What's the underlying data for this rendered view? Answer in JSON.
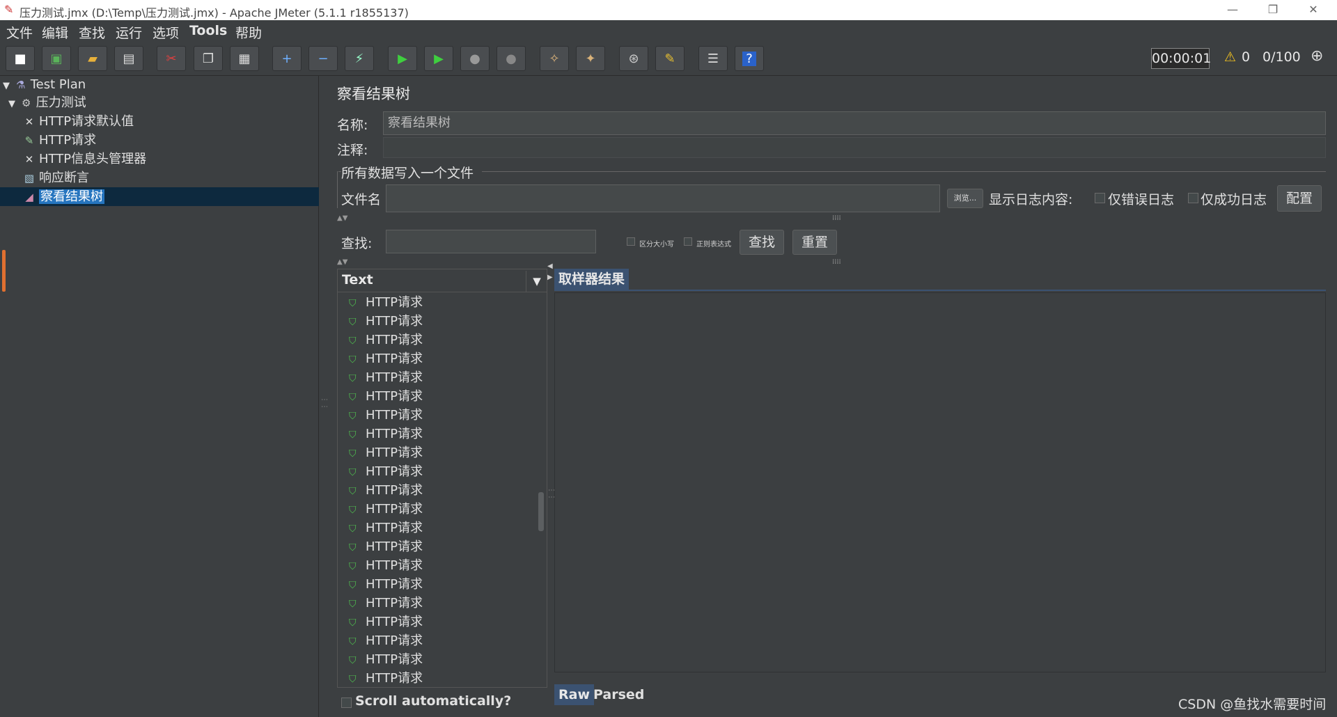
{
  "window": {
    "title": "压力测试.jmx (D:\\Temp\\压力测试.jmx) - Apache JMeter (5.1.1 r1855137)",
    "minimize": "—",
    "restore": "❐",
    "close": "✕"
  },
  "menu": [
    "文件",
    "编辑",
    "查找",
    "运行",
    "选项",
    "Tools",
    "帮助"
  ],
  "toolbar": {
    "icons": [
      "new-icon",
      "templates-icon",
      "open-icon",
      "save-icon",
      "cut-icon",
      "copy-icon",
      "paste-icon",
      "expand-icon",
      "collapse-icon",
      "toggle-icon",
      "start-icon",
      "start-no-pause-icon",
      "stop-icon",
      "shutdown-icon",
      "clear-icon",
      "clear-all-icon",
      "search-icon",
      "reset-search-icon",
      "function-helper-icon",
      "help-icon"
    ],
    "timer": "00:00:01",
    "warnings": "0",
    "threads": "0/100"
  },
  "tree": {
    "items": [
      {
        "label": "Test Plan",
        "icon": "test-plan-icon"
      },
      {
        "label": "压力测试",
        "icon": "thread-group-icon"
      },
      {
        "label": "HTTP请求默认值",
        "icon": "config-icon"
      },
      {
        "label": "HTTP请求",
        "icon": "sampler-icon"
      },
      {
        "label": "HTTP信息头管理器",
        "icon": "config-icon"
      },
      {
        "label": "响应断言",
        "icon": "assertion-icon"
      },
      {
        "label": "察看结果树",
        "icon": "listener-icon"
      }
    ]
  },
  "panel": {
    "title": "察看结果树",
    "name_label": "名称:",
    "name_value": "察看结果树",
    "comment_label": "注释:",
    "file_group_title": "所有数据写入一个文件",
    "filename_label": "文件名",
    "browse_label": "浏览...",
    "log_label": "显示日志内容:",
    "errors_only": "仅错误日志",
    "success_only": "仅成功日志",
    "config_button": "配置",
    "search_label": "查找:",
    "case_sensitive": "区分大小写",
    "regex": "正则表达式",
    "search_button": "查找",
    "reset_button": "重置"
  },
  "results": {
    "renderer": "Text",
    "items": [
      "HTTP请求",
      "HTTP请求",
      "HTTP请求",
      "HTTP请求",
      "HTTP请求",
      "HTTP请求",
      "HTTP请求",
      "HTTP请求",
      "HTTP请求",
      "HTTP请求",
      "HTTP请求",
      "HTTP请求",
      "HTTP请求",
      "HTTP请求",
      "HTTP请求",
      "HTTP请求",
      "HTTP请求",
      "HTTP请求",
      "HTTP请求",
      "HTTP请求",
      "HTTP请求"
    ],
    "scroll_auto": "Scroll automatically?"
  },
  "sampler": {
    "tab_label": "取样器结果",
    "raw_tab": "Raw",
    "parsed_tab": "Parsed"
  },
  "watermark": "CSDN @鱼找水需要时间",
  "colors": {
    "selection": "#2675bf",
    "success": "#4fc24f",
    "tab_active": "#3b5271"
  }
}
